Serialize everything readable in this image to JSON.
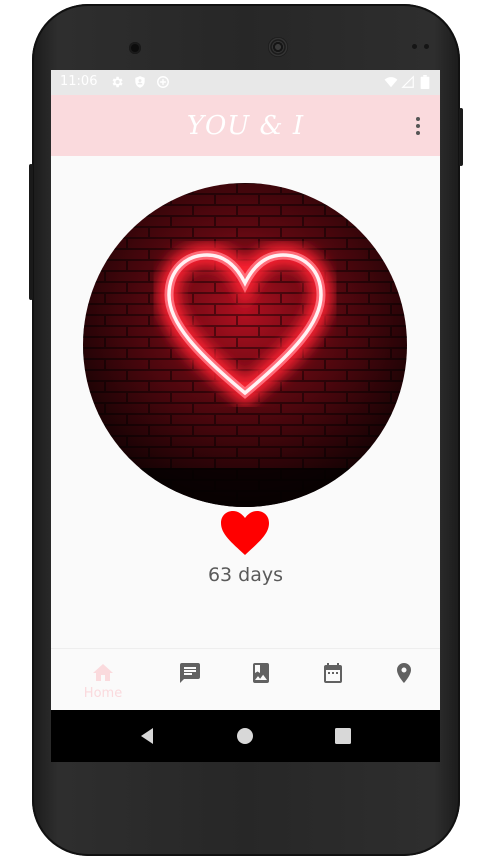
{
  "status_bar": {
    "time": "11:06"
  },
  "app_bar": {
    "title": "YOU & I",
    "menu_icon": "more-vert-icon"
  },
  "main": {
    "photo_description_icon": "neon-heart-photo",
    "heart_icon": "heart-icon",
    "days_text": "63 days"
  },
  "bottom_nav": {
    "items": [
      {
        "label": "Home",
        "icon": "home-icon",
        "active": true
      },
      {
        "label": "",
        "icon": "chat-icon"
      },
      {
        "label": "",
        "icon": "photo-album-icon"
      },
      {
        "label": "",
        "icon": "calendar-icon"
      },
      {
        "label": "",
        "icon": "location-pin-icon"
      }
    ]
  },
  "colors": {
    "accent_pink": "#fadadd",
    "heart_red": "#ff0000",
    "icon_gray": "#616161"
  }
}
